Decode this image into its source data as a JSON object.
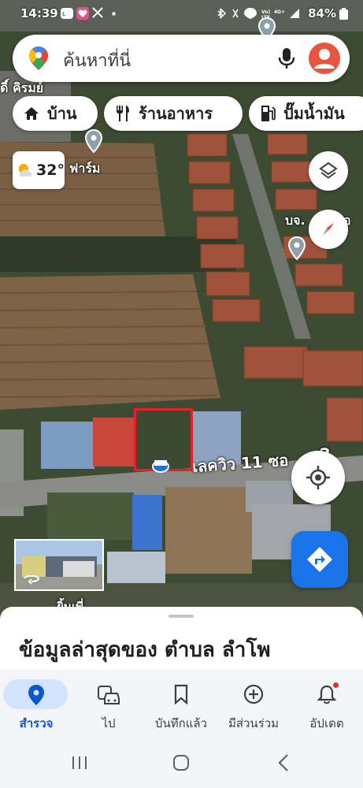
{
  "status_bar": {
    "time": "14:39",
    "battery": "84%"
  },
  "search": {
    "placeholder": "ค้นหาที่นี่"
  },
  "chips": [
    {
      "label": "บ้าน",
      "icon": "home-icon"
    },
    {
      "label": "ร้านอาหาร",
      "icon": "restaurant-icon"
    },
    {
      "label": "ปั๊มน้ำมัน",
      "icon": "gas-station-icon"
    }
  ],
  "weather": {
    "temperature": "32°",
    "icon": "partly-sunny-icon"
  },
  "map_labels": {
    "farm": "ฟาร์ม",
    "top_left_place": "ดิ์ คิรมย์",
    "company": "บจ.",
    "company_suffix": "อ",
    "street": "เลควิว 11 ซอ",
    "street_suffix": "2",
    "bottom_partial": "ยิ้นเพี่"
  },
  "bottom_sheet": {
    "title": "ข้อมูลล่าสุดของ ตำบล ลำโพ"
  },
  "bottom_nav": [
    {
      "label": "สำรวจ",
      "icon": "explore-pin-icon",
      "active": true
    },
    {
      "label": "ไป",
      "icon": "commute-icon",
      "active": false
    },
    {
      "label": "บันทึกแล้ว",
      "icon": "bookmark-icon",
      "active": false
    },
    {
      "label": "มีส่วนร่วม",
      "icon": "contribute-icon",
      "active": false
    },
    {
      "label": "อัปเดต",
      "icon": "bell-icon",
      "active": false
    }
  ],
  "colors": {
    "accent": "#1a73e8",
    "highlight_box": "#e5202a",
    "nav_active_pill": "#d3e3fd"
  }
}
